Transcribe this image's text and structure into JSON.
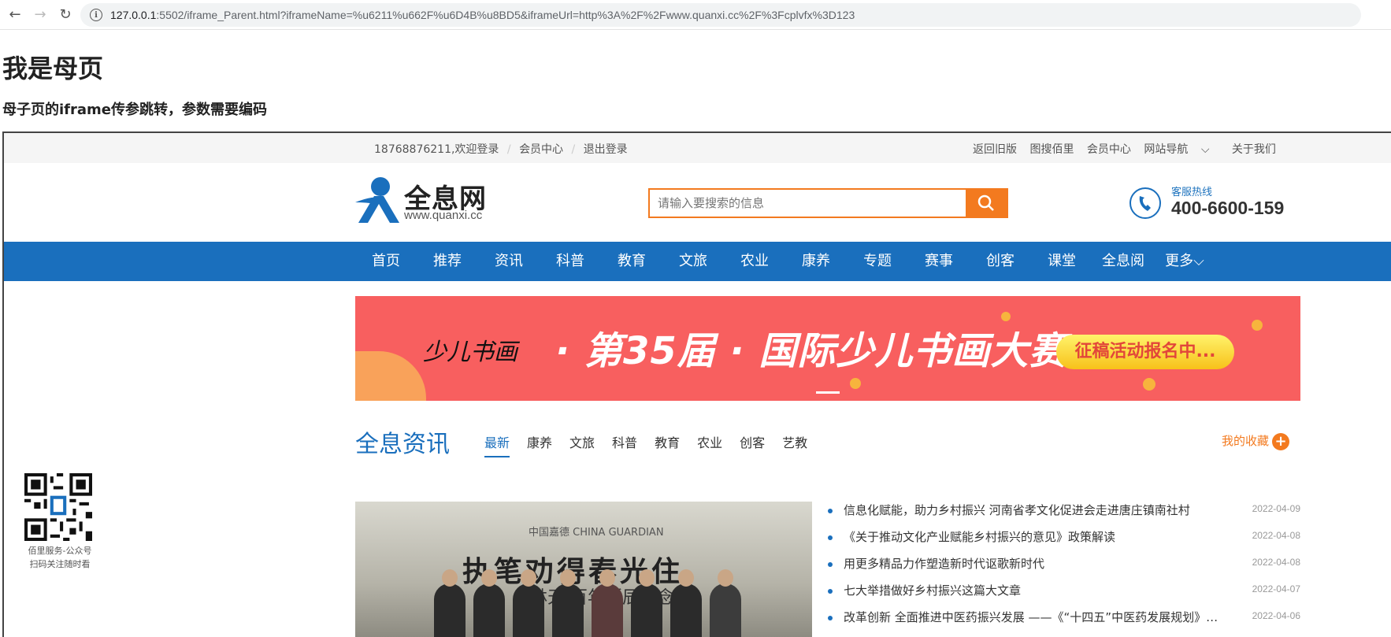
{
  "browser": {
    "url_host": "127.0.0.1",
    "url_rest": ":5502/iframe_Parent.html?iframeName=%u6211%u662F%u6D4B%u8BD5&iframeUrl=http%3A%2F%2Fwww.quanxi.cc%2F%3Fcplvfx%3D123"
  },
  "parent": {
    "title": "我是母页",
    "subtitle": "母子页的iframe传参跳转，参数需要编码"
  },
  "topbar": {
    "user": "18768876211,欢迎登录",
    "sep1": "/",
    "member": "会员中心",
    "sep2": "/",
    "logout": "退出登录",
    "old_version": "返回旧版",
    "image_search": "图搜佰里",
    "member_center": "会员中心",
    "site_nav": "网站导航",
    "about": "关于我们"
  },
  "header": {
    "logo_name": "全息网",
    "logo_domain": "www.quanxi.cc",
    "search_placeholder": "请输入要搜索的信息",
    "hotline_label": "客服热线",
    "hotline_number": "400-6600-159"
  },
  "nav": {
    "items": [
      "首页",
      "推荐",
      "资讯",
      "科普",
      "教育",
      "文旅",
      "农业",
      "康养",
      "专题",
      "赛事",
      "创客",
      "课堂",
      "全息阅",
      "更多"
    ]
  },
  "banner": {
    "signature": "少儿书画",
    "headline": "· 第35届 · 国际少儿书画大赛",
    "button": "征稿活动报名中..."
  },
  "news_section": {
    "title": "全息资讯",
    "tabs": [
      "最新",
      "康养",
      "文旅",
      "科普",
      "教育",
      "农业",
      "创客",
      "艺教"
    ],
    "favorites": "我的收藏",
    "image_caption_small": "中国嘉德 CHINA GUARDIAN",
    "image_caption_big": "执笔劝得春光住",
    "image_caption_sub": "—林天 百年诞辰纪念展",
    "items": [
      {
        "title": "信息化赋能，助力乡村振兴 河南省孝文化促进会走进唐庄镇南社村",
        "date": "2022-04-09"
      },
      {
        "title": "《关于推动文化产业赋能乡村振兴的意见》政策解读",
        "date": "2022-04-08"
      },
      {
        "title": "用更多精品力作塑造新时代讴歌新时代",
        "date": "2022-04-08"
      },
      {
        "title": "七大举措做好乡村振兴这篇大文章",
        "date": "2022-04-07"
      },
      {
        "title": "改革创新 全面推进中医药振兴发展 ——《“十四五”中医药发展规划》解读",
        "date": "2022-04-06"
      }
    ]
  },
  "qr": {
    "line1": "佰里服务-公众号",
    "line2": "扫码关注随时看"
  }
}
